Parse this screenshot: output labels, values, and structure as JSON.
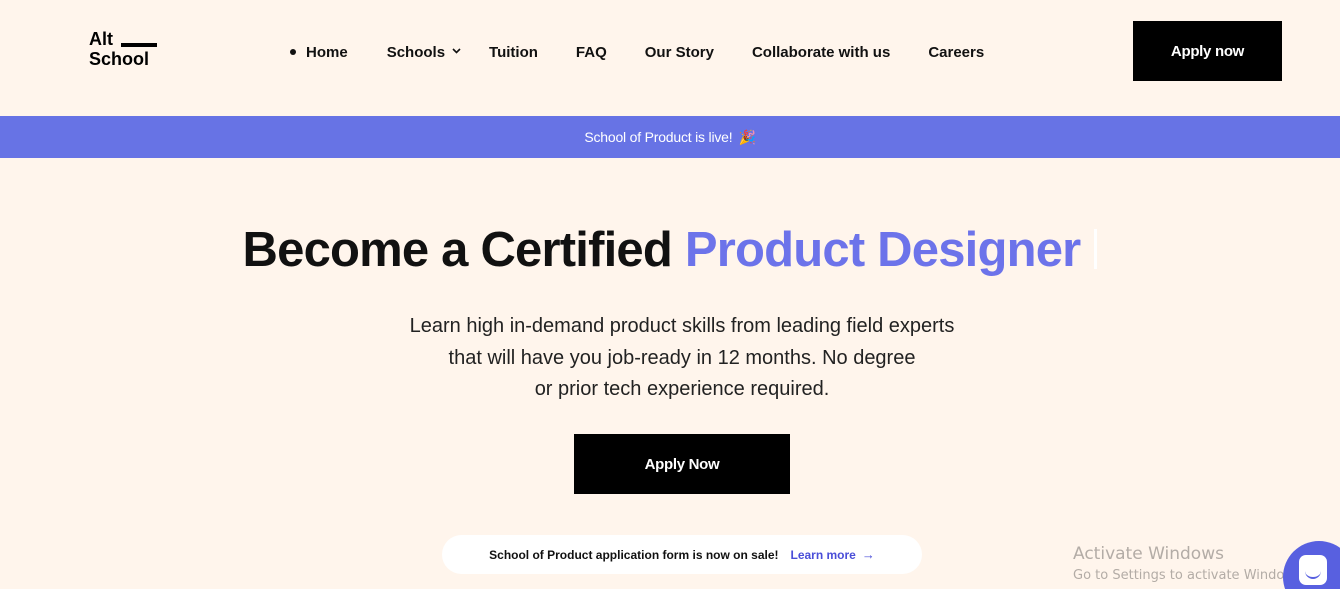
{
  "header": {
    "logo_line1": "Alt",
    "logo_line2": "School",
    "nav": [
      {
        "label": "Home"
      },
      {
        "label": "Schools"
      },
      {
        "label": "Tuition"
      },
      {
        "label": "FAQ"
      },
      {
        "label": "Our Story"
      },
      {
        "label": "Collaborate with us"
      },
      {
        "label": "Careers"
      }
    ],
    "apply_label": "Apply now"
  },
  "banner": {
    "text": "School of Product is live!",
    "emoji": "🎉"
  },
  "hero": {
    "title_plain": "Become a Certified ",
    "title_accent": "Product Designer",
    "subtitle_lines": [
      "Learn high in-demand product skills from leading field experts",
      "that will have you job-ready in 12 months. No degree",
      "or prior tech experience required."
    ],
    "apply_label": "Apply Now"
  },
  "notice": {
    "text": "School of Product application form is now on sale!",
    "link_label": "Learn more",
    "arrow": "→"
  },
  "watermark": {
    "line1": "Activate Windows",
    "line2": "Go to Settings to activate Windows."
  },
  "colors": {
    "background": "#fff5ec",
    "accent": "#6c73ea",
    "banner": "#6773e5",
    "button": "#000000",
    "link": "#4a4ed8"
  },
  "icons": {
    "nav_active": "dot-icon",
    "schools_dropdown": "chevron-down-icon",
    "notice_link": "arrow-right-icon",
    "chat": "chat-icon"
  }
}
